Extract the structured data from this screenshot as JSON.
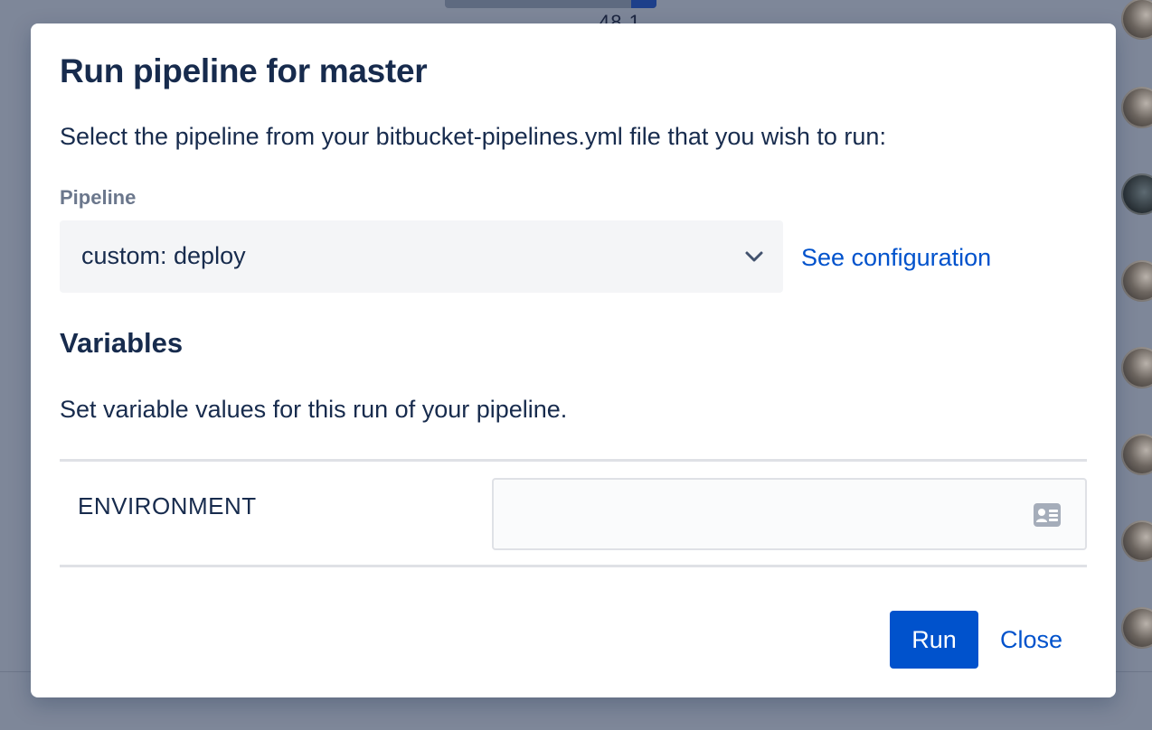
{
  "background": {
    "progress": 0.12,
    "number_text": "48 1",
    "avatar_count": 8
  },
  "modal": {
    "title": "Run pipeline for master",
    "description": "Select the pipeline from your bitbucket-pipelines.yml file that you wish to run:",
    "pipeline": {
      "label": "Pipeline",
      "selected": "custom: deploy",
      "icon": "chevron-down-icon"
    },
    "see_configuration": "See configuration",
    "variables": {
      "title": "Variables",
      "description": "Set variable values for this run of your pipeline.",
      "rows": [
        {
          "name": "ENVIRONMENT",
          "value": "",
          "icon": "contact-card-icon"
        }
      ]
    },
    "actions": {
      "run": "Run",
      "close": "Close"
    }
  },
  "colors": {
    "overlay": "#7e8799",
    "primary": "#0052cc",
    "text": "#172b4d",
    "muted": "#6b778c",
    "field_bg": "#f4f5f7",
    "border": "#dfe1e6"
  }
}
